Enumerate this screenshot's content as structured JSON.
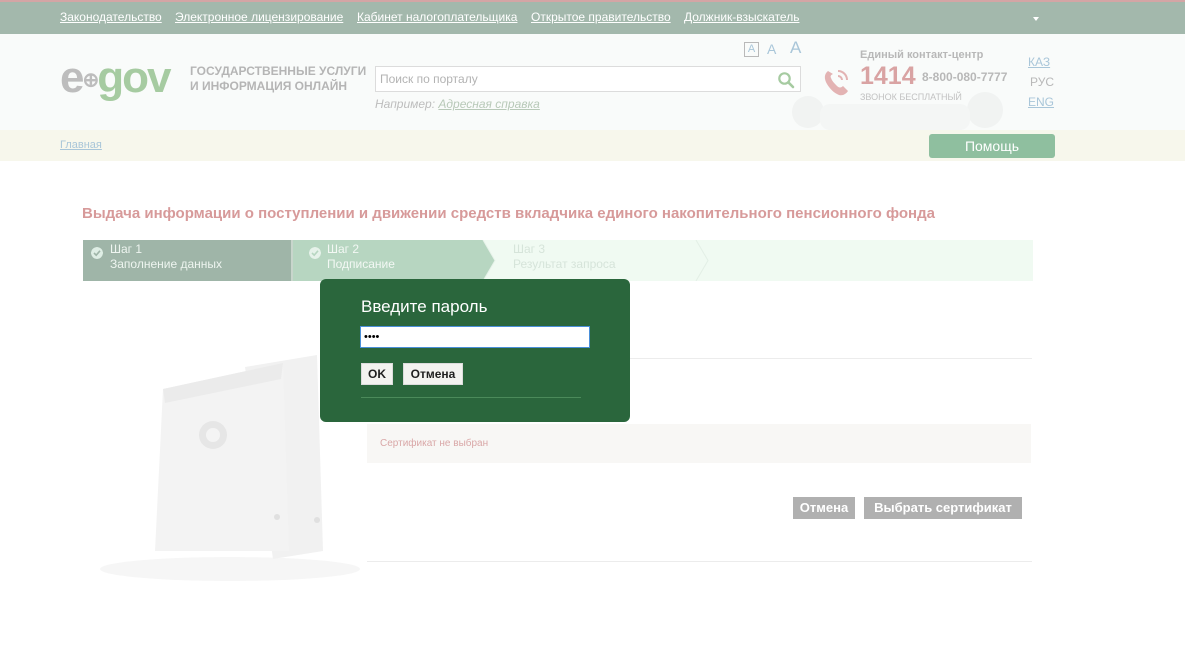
{
  "topnav": {
    "links": [
      "Законодательство",
      "Электронное лицензирование",
      "Кабинет налогоплательщика",
      "Открытое правительство",
      "Должник-взыскатель"
    ]
  },
  "header": {
    "logo_e": "e",
    "logo_gov": "gov",
    "tagline_line1": "ГОСУДАРСТВЕННЫЕ УСЛУГИ",
    "tagline_line2": "И ИНФОРМАЦИЯ ОНЛАЙН",
    "font_sizes": [
      "A",
      "A",
      "A"
    ],
    "search_placeholder": "Поиск по порталу",
    "example_prefix": "Например:",
    "example_link": "Адресная справка",
    "contact_title": "Единый контакт-центр",
    "contact_number": "1414",
    "contact_phone": "8-800-080-7777",
    "contact_free": "ЗВОНОК БЕСПЛАТНЫЙ",
    "languages": [
      "КАЗ",
      "РУС",
      "ENG"
    ]
  },
  "breadcrumb": {
    "home": "Главная",
    "help_button": "Помощь"
  },
  "main": {
    "title": "Выдача информации о поступлении и движении средств вкладчика единого накопительного пенсионного фонда",
    "steps": [
      {
        "num": "Шаг 1",
        "name": "Заполнение данных"
      },
      {
        "num": "Шаг 2",
        "name": "Подписание"
      },
      {
        "num": "Шаг 3",
        "name": "Результат запроса"
      }
    ],
    "cert_status": "Сертификат не выбран",
    "cancel_button": "Отмена",
    "choose_cert_button": "Выбрать сертификат"
  },
  "dialog": {
    "title": "Введите пароль",
    "password_value": "••••",
    "ok_button": "OK",
    "cancel_button": "Отмена"
  },
  "colors": {
    "topbar": "#a3b8ac",
    "dialog_bg": "#2a663c",
    "help_button": "#8fbf9f",
    "title_accent": "#d79a9a"
  }
}
